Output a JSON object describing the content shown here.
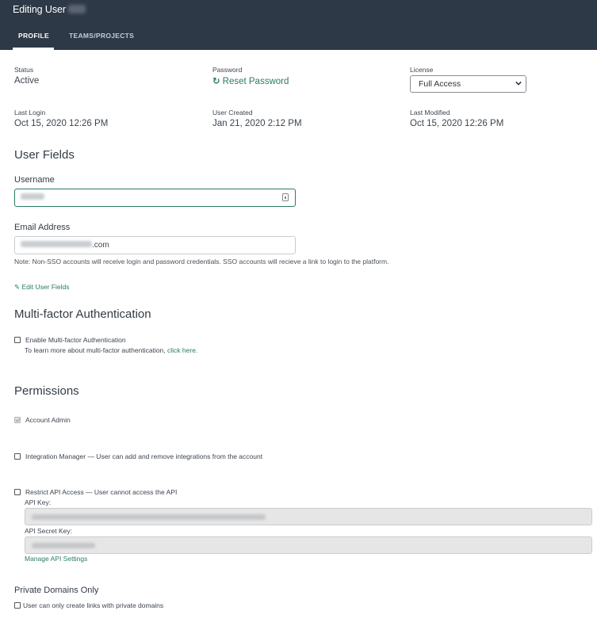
{
  "header": {
    "title": "Editing User",
    "tabs": [
      {
        "label": "PROFILE",
        "active": true
      },
      {
        "label": "TEAMS/PROJECTS",
        "active": false
      }
    ]
  },
  "summary": {
    "status_label": "Status",
    "status_value": "Active",
    "password_label": "Password",
    "reset_password": "Reset Password",
    "license_label": "License",
    "license_value": "Full Access",
    "last_login_label": "Last Login",
    "last_login_value": "Oct 15, 2020 12:26 PM",
    "user_created_label": "User Created",
    "user_created_value": "Jan 21, 2020 2:12 PM",
    "last_modified_label": "Last Modified",
    "last_modified_value": "Oct 15, 2020 12:26 PM"
  },
  "user_fields": {
    "heading": "User Fields",
    "username_label": "Username",
    "email_label": "Email Address",
    "email_suffix": ".com",
    "note": "Note: Non-SSO accounts will receive login and password credentials. SSO accounts will recieve a link to login to the platform.",
    "edit_link": "Edit User Fields"
  },
  "mfa": {
    "heading": "Multi-factor Authentication",
    "enable_label": "Enable Multi-factor Authentication",
    "learn_more": "To learn more about multi-factor authentication,",
    "click_here": "click here."
  },
  "permissions": {
    "heading": "Permissions",
    "account_admin": "Account Admin",
    "integration_manager": "Integration Manager — User can add and remove integrations from the account",
    "restrict_api": "Restrict API Access — User cannot access the API",
    "api_key_label": "API Key:",
    "api_secret_label": "API Secret Key:",
    "manage_api": "Manage API Settings"
  },
  "private_domains": {
    "heading": "Private Domains Only",
    "label": "User can only create links with private domains"
  },
  "colors": {
    "header_bg": "#2e3947",
    "accent": "#2a7a67"
  },
  "icons": [
    "refresh-icon",
    "chevron-down-icon",
    "pencil-icon",
    "lock-icon"
  ]
}
